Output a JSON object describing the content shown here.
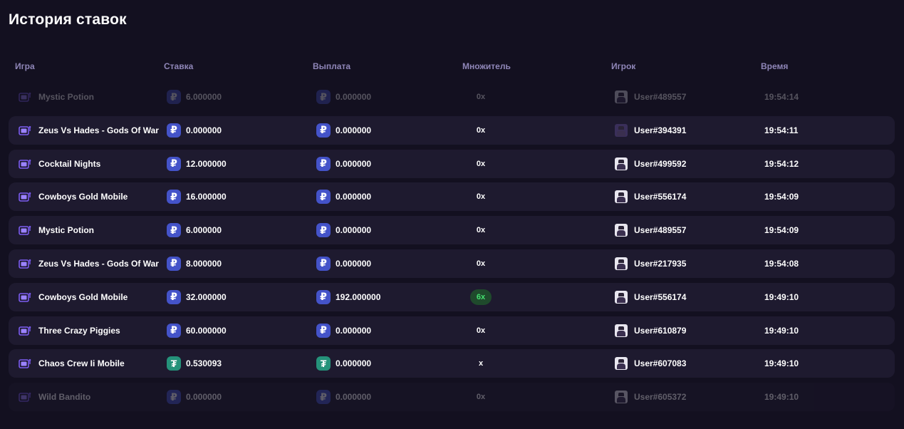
{
  "page": {
    "title": "История ставок"
  },
  "columns": {
    "game": "Игра",
    "bet": "Ставка",
    "payout": "Выплата",
    "multiplier": "Множитель",
    "player": "Игрок",
    "time": "Время"
  },
  "icons": {
    "game": "slot-machine-icon",
    "rub": "ruble-icon",
    "usdt": "tether-icon",
    "avatar": "user-avatar"
  },
  "colors": {
    "background": "#131020",
    "row": "#1e1a2f",
    "header_text": "#8f86b8",
    "rub_coin": "#4453c9",
    "usdt_coin": "#25927a",
    "win_badge": "#44e070"
  },
  "rows": [
    {
      "game": "Mystic Potion",
      "currency": "rub",
      "currency_symbol": "₽",
      "bet": "6.000000",
      "payout": "0.000000",
      "multiplier": "0x",
      "win": false,
      "player": "User#489557",
      "time": "19:54:14",
      "faded": true
    },
    {
      "game": "Zeus Vs Hades - Gods Of War M",
      "currency": "rub",
      "currency_symbol": "₽",
      "bet": "0.000000",
      "payout": "0.000000",
      "multiplier": "0x",
      "win": false,
      "player": "User#394391",
      "time": "19:54:11",
      "faded": false
    },
    {
      "game": "Cocktail Nights",
      "currency": "rub",
      "currency_symbol": "₽",
      "bet": "12.000000",
      "payout": "0.000000",
      "multiplier": "0x",
      "win": false,
      "player": "User#499592",
      "time": "19:54:12",
      "faded": false
    },
    {
      "game": "Cowboys Gold Mobile",
      "currency": "rub",
      "currency_symbol": "₽",
      "bet": "16.000000",
      "payout": "0.000000",
      "multiplier": "0x",
      "win": false,
      "player": "User#556174",
      "time": "19:54:09",
      "faded": false
    },
    {
      "game": "Mystic Potion",
      "currency": "rub",
      "currency_symbol": "₽",
      "bet": "6.000000",
      "payout": "0.000000",
      "multiplier": "0x",
      "win": false,
      "player": "User#489557",
      "time": "19:54:09",
      "faded": false
    },
    {
      "game": "Zeus Vs Hades - Gods Of War M",
      "currency": "rub",
      "currency_symbol": "₽",
      "bet": "8.000000",
      "payout": "0.000000",
      "multiplier": "0x",
      "win": false,
      "player": "User#217935",
      "time": "19:54:08",
      "faded": false
    },
    {
      "game": "Cowboys Gold Mobile",
      "currency": "rub",
      "currency_symbol": "₽",
      "bet": "32.000000",
      "payout": "192.000000",
      "multiplier": "6x",
      "win": true,
      "player": "User#556174",
      "time": "19:49:10",
      "faded": false
    },
    {
      "game": "Three Crazy Piggies",
      "currency": "rub",
      "currency_symbol": "₽",
      "bet": "60.000000",
      "payout": "0.000000",
      "multiplier": "0x",
      "win": false,
      "player": "User#610879",
      "time": "19:49:10",
      "faded": false
    },
    {
      "game": "Chaos Crew Ii Mobile",
      "currency": "usdt",
      "currency_symbol": "₮",
      "bet": "0.530093",
      "payout": "0.000000",
      "multiplier": "x",
      "win": false,
      "player": "User#607083",
      "time": "19:49:10",
      "faded": false
    },
    {
      "game": "Wild Bandito",
      "currency": "rub",
      "currency_symbol": "₽",
      "bet": "0.000000",
      "payout": "0.000000",
      "multiplier": "0x",
      "win": false,
      "player": "User#605372",
      "time": "19:49:10",
      "faded": true
    }
  ]
}
